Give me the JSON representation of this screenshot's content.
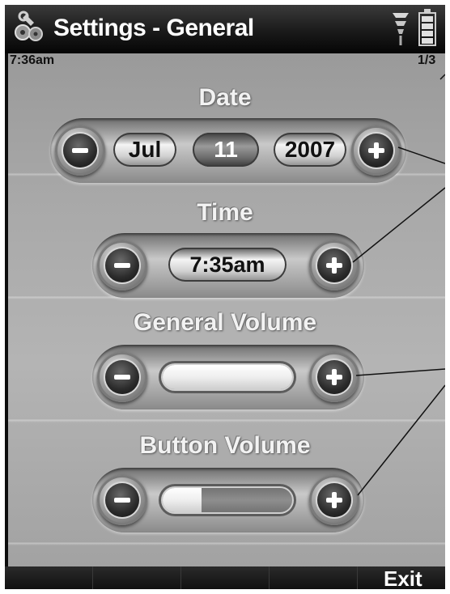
{
  "header": {
    "title": "Settings - General",
    "clock": "7:36am",
    "page_indicator": "1/3",
    "icons": {
      "app": "settings-wrench-icon",
      "signal": "signal-strength-icon",
      "battery": "battery-icon"
    }
  },
  "date": {
    "label": "Date",
    "month": "Jul",
    "day": "11",
    "year": "2007",
    "decrease_icon": "minus-icon",
    "increase_icon": "plus-icon"
  },
  "time": {
    "label": "Time",
    "value": "7:35am",
    "decrease_icon": "minus-icon",
    "increase_icon": "plus-icon"
  },
  "general_volume": {
    "label": "General Volume",
    "level": 1.0
  },
  "button_volume": {
    "label": "Button Volume",
    "level": 0.3
  },
  "softkeys": {
    "right_label": "Exit"
  },
  "colors": {
    "titlebar": "#1a1a1a",
    "screen_background": "#a9a9a9",
    "label_text": "#f2f2f2",
    "button_dark": "#2b2b2b"
  }
}
